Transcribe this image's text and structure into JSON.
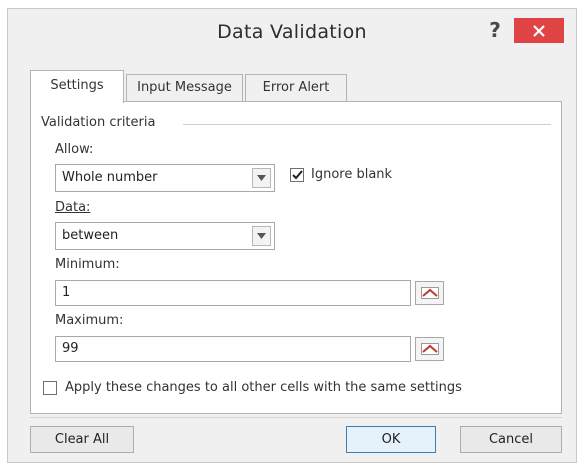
{
  "window": {
    "title": "Data Validation",
    "help_label": "?"
  },
  "tabs": [
    {
      "label": "Settings",
      "active": true
    },
    {
      "label": "Input Message",
      "active": false
    },
    {
      "label": "Error Alert",
      "active": false
    }
  ],
  "settings": {
    "section_label": "Validation criteria",
    "allow_label": "Allow:",
    "allow_value": "Whole number",
    "ignore_blank_label": "Ignore blank",
    "ignore_blank_checked": true,
    "data_label": "Data:",
    "data_value": "between",
    "minimum_label": "Minimum:",
    "minimum_value": "1",
    "maximum_label": "Maximum:",
    "maximum_value": "99",
    "apply_all_label": "Apply these changes to all other cells with the same settings",
    "apply_all_checked": false
  },
  "buttons": {
    "clear_all": "Clear All",
    "ok": "OK",
    "cancel": "Cancel"
  },
  "colors": {
    "close_button": "#e04343",
    "dialog_bg": "#f0f0f0",
    "collapse_icon": "#c0392b"
  }
}
